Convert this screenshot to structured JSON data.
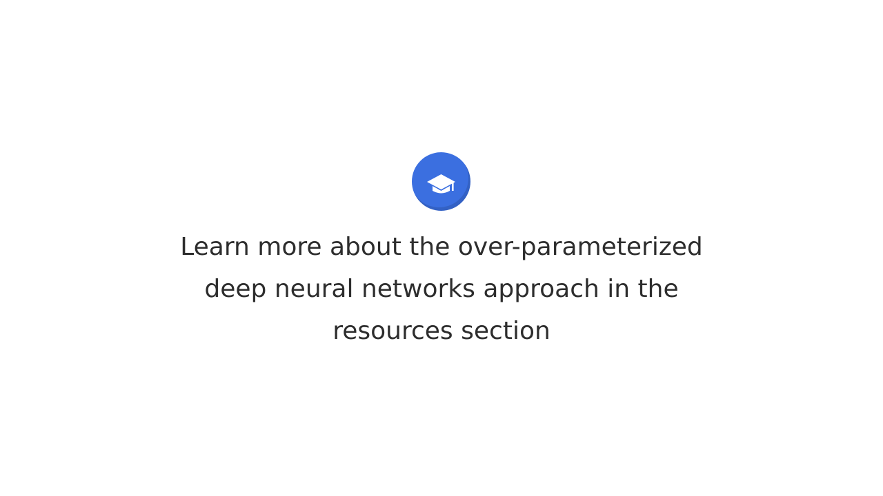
{
  "message": {
    "line1": "Learn more about the over-parameterized",
    "line2": "deep neural networks approach in the",
    "line3": "resources section"
  },
  "icon": {
    "name": "graduation-cap-icon",
    "badge_color": "#3b6fe0",
    "glyph_color": "#ffffff"
  },
  "colors": {
    "background": "#ffffff",
    "text": "#2d2d2d"
  }
}
